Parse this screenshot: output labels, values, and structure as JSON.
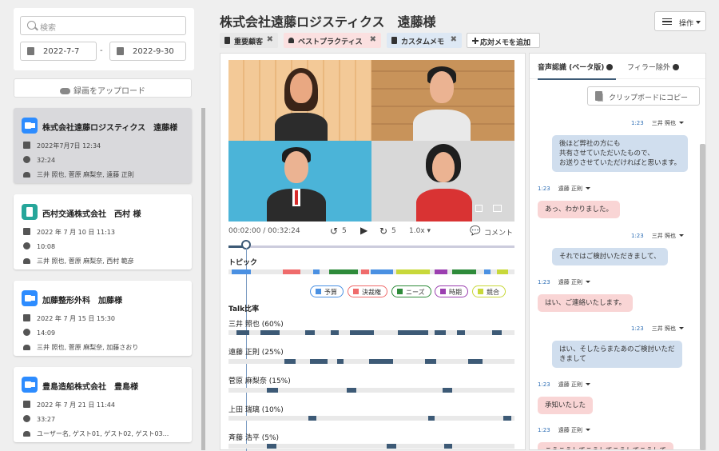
{
  "sidebar": {
    "search_placeholder": "検索",
    "date_from": "2022-7-7",
    "date_sep": "-",
    "date_to": "2022-9-30",
    "upload_label": "録画をアップロード",
    "meetings": [
      {
        "title": "株式会社遠藤ロジスティクス　遠藤様",
        "date": "2022年7月7日 12:34",
        "duration": "32:24",
        "participants": "三井 照也, 菅原 麻梨奈, 遠藤 正則",
        "icon": "zoom"
      },
      {
        "title": "西村交通株式会社　西村 様",
        "date": "2022 年 7 月 10 日 11:13",
        "duration": "10:08",
        "participants": "三井 照也, 菅原 麻梨奈, 西村 範彦",
        "icon": "doc"
      },
      {
        "title": "加藤整形外科　加藤様",
        "date": "2022 年 7 月 15 日 15:30",
        "duration": "14:09",
        "participants": "三井 照也, 菅原 麻梨奈, 加藤さおり",
        "icon": "zoom"
      },
      {
        "title": "豊島造船株式会社　豊島様",
        "date": "2022 年 7 月 21 日 11:44",
        "duration": "33:27",
        "participants": "ユーザー名, ゲスト01, ゲスト02, ゲスト03...",
        "icon": "zoom"
      }
    ]
  },
  "header": {
    "title": "株式会社遠藤ロジスティクス　遠藤様",
    "operations_label": "操作"
  },
  "tags": [
    {
      "label": "重要顧客",
      "style": "gray"
    },
    {
      "label": "ベストプラクティス",
      "style": "pink"
    },
    {
      "label": "カスタムメモ",
      "style": "blue"
    },
    {
      "label": "応対メモを追加",
      "style": "add"
    }
  ],
  "player": {
    "time": "00:02:00 / 00:32:24",
    "rewind_seconds": "5",
    "forward_seconds": "5",
    "speed": "1.0x",
    "comment_label": "コメント",
    "progress": 0.062
  },
  "topic": {
    "label": "トピック",
    "legend": [
      {
        "label": "予算",
        "color": "#4a90e2"
      },
      {
        "label": "決裁権",
        "color": "#ef6b6b"
      },
      {
        "label": "ニーズ",
        "color": "#2e8b3a"
      },
      {
        "label": "時期",
        "color": "#9b3fb0"
      },
      {
        "label": "競合",
        "color": "#c8d83a"
      }
    ]
  },
  "talk": {
    "label": "Talk比率",
    "speakers": [
      {
        "name": "三井 照也 (60%)"
      },
      {
        "name": "遠藤 正則 (25%)"
      },
      {
        "name": "菅原 麻梨奈 (15%)"
      },
      {
        "name": "上田 瑞璃 (10%)"
      },
      {
        "name": "斉藤 浩平 (5%)"
      }
    ]
  },
  "transcript": {
    "tab_active": "音声認識 (ベータ版)",
    "tab_other": "フィラー除外",
    "copy_label": "クリップボードにコピー",
    "messages": [
      {
        "time": "1:23",
        "speaker": "三井 照也",
        "side": "r",
        "text": "後ほど弊社の方にも\n共有させていただいたもので、\nお送りさせていただければと思います。"
      },
      {
        "time": "1:23",
        "speaker": "遠藤 正則",
        "side": "l",
        "text": "あっ、わかりました。"
      },
      {
        "time": "1:23",
        "speaker": "三井 照也",
        "side": "r",
        "text": "それではご検討いただきまして、"
      },
      {
        "time": "1:23",
        "speaker": "遠藤 正則",
        "side": "l",
        "text": "はい、ご連絡いたします。"
      },
      {
        "time": "1:23",
        "speaker": "三井 照也",
        "side": "r",
        "text": "はい、そしたらまたあのご検討いただ\nきまして"
      },
      {
        "time": "1:23",
        "speaker": "遠藤 正則",
        "side": "l",
        "text": "承知いたした"
      },
      {
        "time": "1:23",
        "speaker": "遠藤 正則",
        "side": "l",
        "text": "こうこうしてこうしてこうしてこうして"
      }
    ]
  }
}
